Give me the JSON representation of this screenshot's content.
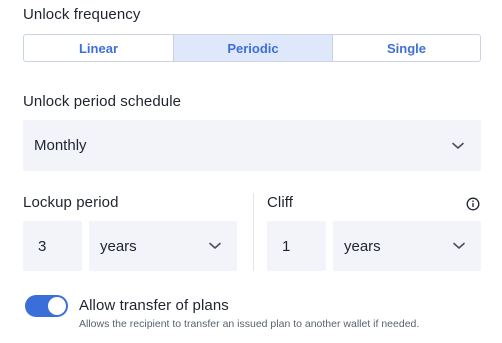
{
  "unlock_frequency": {
    "label": "Unlock frequency",
    "options": [
      "Linear",
      "Periodic",
      "Single"
    ],
    "selected": "Periodic"
  },
  "unlock_period_schedule": {
    "label": "Unlock period schedule",
    "value": "Monthly"
  },
  "lockup_period": {
    "label": "Lockup period",
    "amount": "3",
    "unit": "years"
  },
  "cliff": {
    "label": "Cliff",
    "amount": "1",
    "unit": "years",
    "info_icon": "info-icon"
  },
  "transfer": {
    "label": "Allow transfer of plans",
    "help": "Allows the recipient to transfer an issued plan to another wallet if needed.",
    "enabled": true
  },
  "colors": {
    "accent": "#3a6fd9",
    "field_bg": "#f2f4fa",
    "segment_active_bg": "#dfe8fb"
  }
}
